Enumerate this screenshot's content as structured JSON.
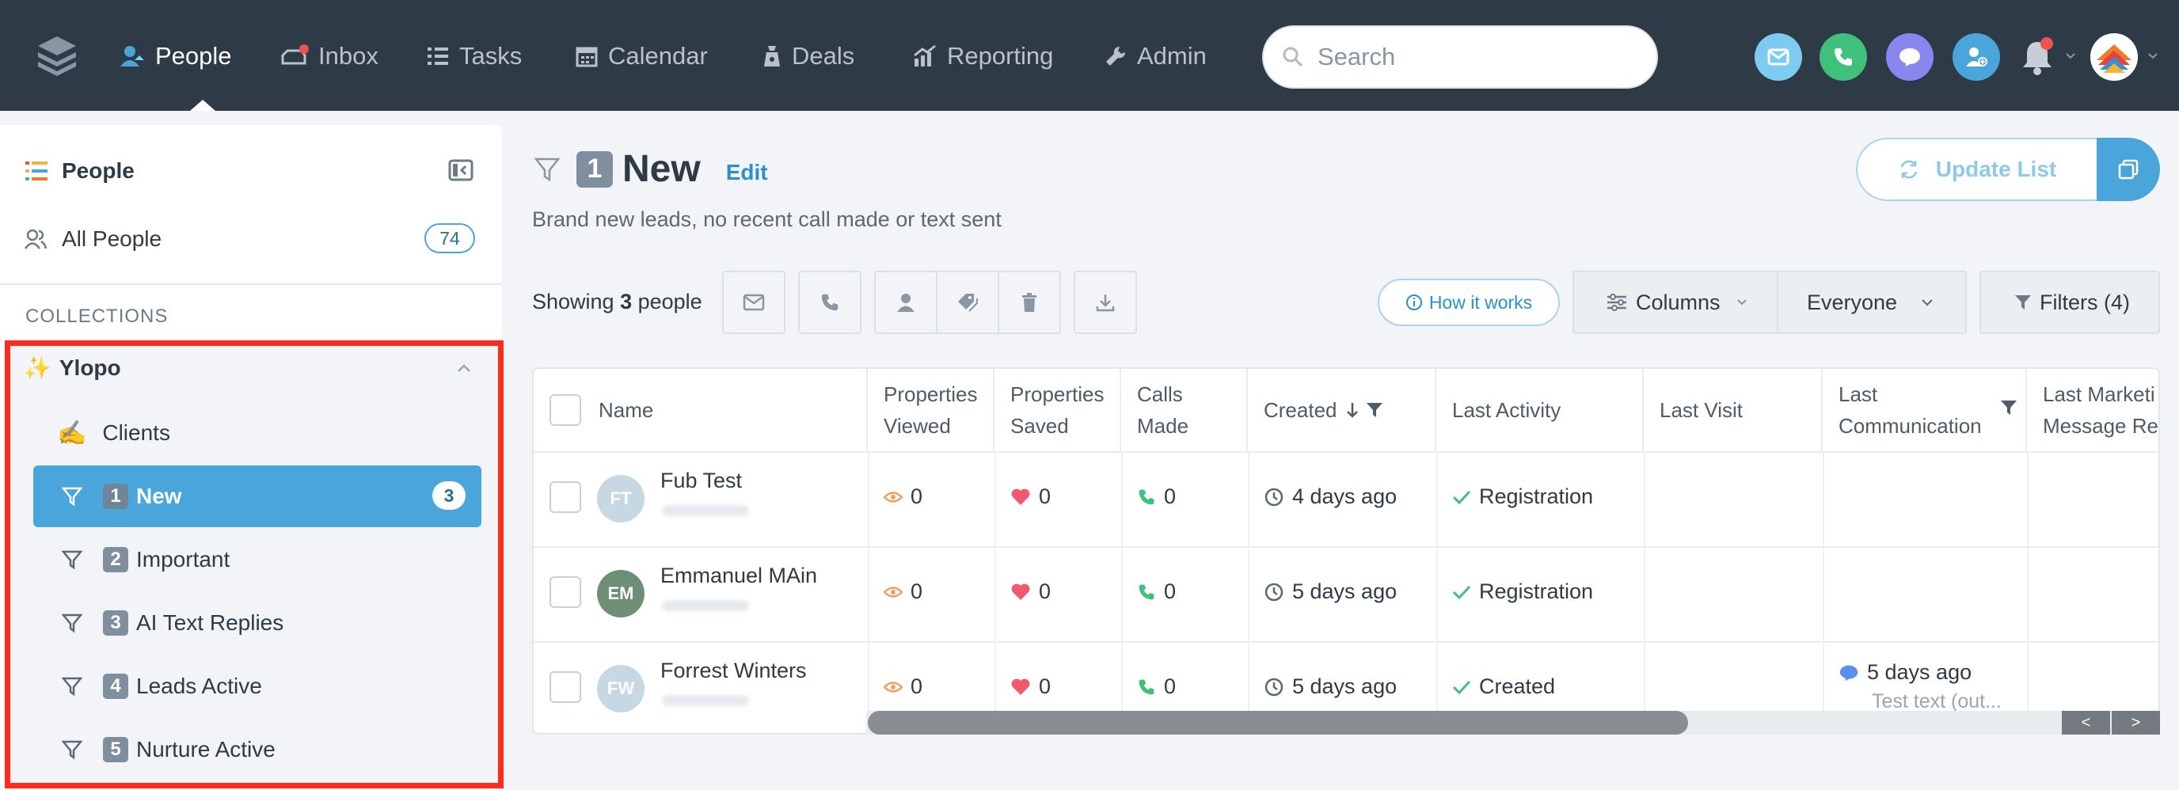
{
  "nav": {
    "items": [
      {
        "label": "People",
        "icon": "person-icon"
      },
      {
        "label": "Inbox",
        "icon": "inbox-icon"
      },
      {
        "label": "Tasks",
        "icon": "tasks-icon"
      },
      {
        "label": "Calendar",
        "icon": "calendar-icon"
      },
      {
        "label": "Deals",
        "icon": "deals-icon"
      },
      {
        "label": "Reporting",
        "icon": "reporting-icon"
      },
      {
        "label": "Admin",
        "icon": "wrench-icon"
      }
    ],
    "search_placeholder": "Search",
    "colors": {
      "bg": "#2e3a46",
      "accent": "#4aa6da"
    }
  },
  "sidebar": {
    "title": "People",
    "all_people": {
      "label": "All People",
      "count": "74"
    },
    "collections_heading": "COLLECTIONS",
    "group": {
      "emoji": "✨",
      "name": "Ylopo",
      "items": [
        {
          "emoji": "✍️",
          "label": "Clients"
        },
        {
          "badge": "1",
          "label": "New",
          "count": "3"
        },
        {
          "badge": "2",
          "label": "Important"
        },
        {
          "badge": "3",
          "label": "AI Text Replies"
        },
        {
          "badge": "4",
          "label": "Leads Active"
        },
        {
          "badge": "5",
          "label": "Nurture Active"
        }
      ]
    }
  },
  "main": {
    "title_badge": "1",
    "title": "New",
    "edit": "Edit",
    "subtitle": "Brand new leads, no recent call made or text sent",
    "update_list": "Update List",
    "showing_prefix": "Showing ",
    "showing_count": "3",
    "showing_suffix": " people",
    "how_it_works": "How it works",
    "columns": "Columns",
    "everyone": "Everyone",
    "filters": "Filters (4)"
  },
  "table": {
    "headers": [
      "Name",
      "Properties Viewed",
      "Properties Saved",
      "Calls Made",
      "Created",
      "Last Activity",
      "Last Visit",
      "Last Communication",
      "Last Marketi Message Re"
    ],
    "header_lines": [
      [
        "Name"
      ],
      [
        "Properties",
        "Viewed"
      ],
      [
        "Properties",
        "Saved"
      ],
      [
        "Calls",
        "Made"
      ],
      [
        "Created"
      ],
      [
        "Last Activity"
      ],
      [
        "Last Visit"
      ],
      [
        "Last",
        "Communication"
      ],
      [
        "Last Marketi",
        "Message Re"
      ]
    ],
    "rows": [
      {
        "initials": "FT",
        "avatar_color": "#c6d8e2",
        "name": "Fub Test",
        "viewed": "0",
        "saved": "0",
        "calls": "0",
        "created": "4 days ago",
        "activity": "Registration",
        "comm_time": "",
        "comm_text": ""
      },
      {
        "initials": "EM",
        "avatar_color": "#6e8f76",
        "name": "Emmanuel MAin",
        "viewed": "0",
        "saved": "0",
        "calls": "0",
        "created": "5 days ago",
        "activity": "Registration",
        "comm_time": "",
        "comm_text": ""
      },
      {
        "initials": "FW",
        "avatar_color": "#c6d8e2",
        "name": "Forrest Winters",
        "viewed": "0",
        "saved": "0",
        "calls": "0",
        "created": "5 days ago",
        "activity": "Created",
        "comm_time": "5 days ago",
        "comm_text": "Test text (out..."
      }
    ],
    "scroll_left": "<",
    "scroll_right": ">"
  }
}
